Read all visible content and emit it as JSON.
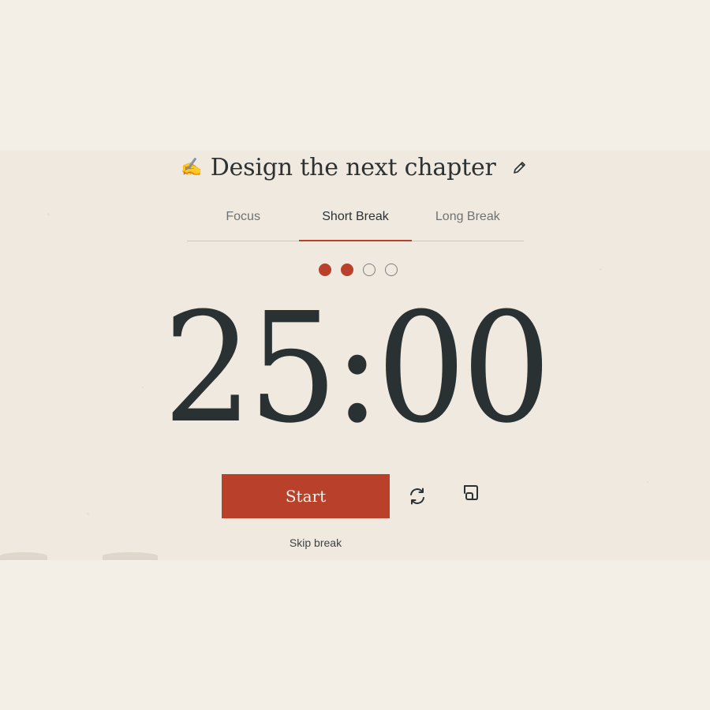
{
  "task": {
    "emoji": "✍️",
    "title": "Design the next chapter"
  },
  "tabs": [
    {
      "label": "Focus",
      "active": false
    },
    {
      "label": "Short Break",
      "active": true
    },
    {
      "label": "Long Break",
      "active": false
    }
  ],
  "session_dots": {
    "completed": 2,
    "total": 4
  },
  "timer": {
    "display": "25:00"
  },
  "controls": {
    "start_label": "Start",
    "reset_icon": "refresh-icon",
    "pip_icon": "picture-in-picture-icon",
    "skip_label": "Skip break"
  },
  "colors": {
    "accent": "#b9412b",
    "background": "#f3efe6",
    "text": "#2c3234"
  }
}
